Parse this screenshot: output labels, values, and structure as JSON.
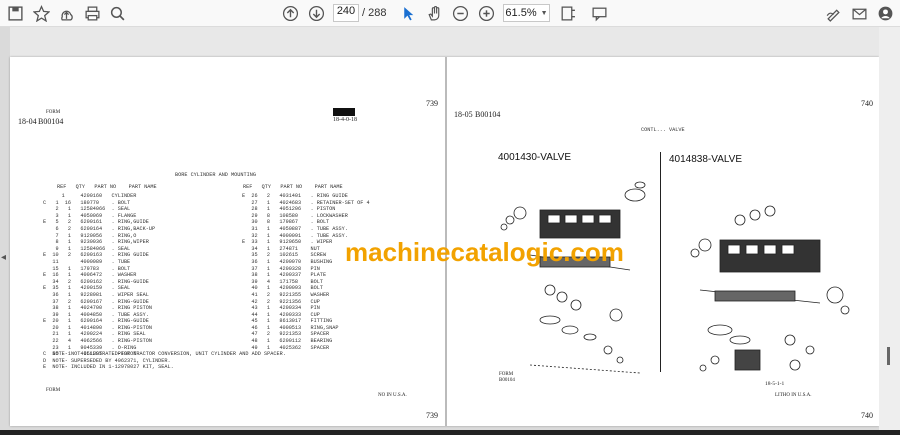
{
  "toolbar": {
    "page_current": "240",
    "page_total": "/ 288",
    "zoom": "61.5%",
    "icons": [
      "save-icon",
      "bookmark-star-icon",
      "upload-icon",
      "print-icon",
      "search-icon",
      "page-up-icon",
      "page-down-icon",
      "select-cursor-icon",
      "hand-icon",
      "zoom-out-icon",
      "zoom-in-icon",
      "fit-page-icon",
      "comment-icon",
      "sign-icon",
      "email-icon",
      "account-icon"
    ]
  },
  "left_page": {
    "page_number_top": "739",
    "page_number_bottom": "739",
    "section": "18-04",
    "form_code": "B00104",
    "form_label": "FORM",
    "stamp": "18-4-0-18",
    "table_title": "BORE CYLINDER AND MOUNTING",
    "col_headers": "REF   QTY   PART NO    PART NAME",
    "col_headers_right": "REF   QTY   PART NO    PART NAME",
    "rows_left": [
      "      1     4200160   CYLINDER",
      "C   1  16   180770    . BOLT",
      "    2   1   12584066  . SEAL",
      "    3   1   4050069   . FLANGE",
      "E   5   2   6200161   . RING,GUIDE",
      "    6   2   6200164   . RING,BACK-UP",
      "    7   1   9120056   . RING,O",
      "    8   1   9230036   . RING,WIPER",
      "    9   1   12584066  . SEAL",
      "E  10   2   6200163   . RING GUIDE",
      "   11       4000089   . TUBE",
      "   15   1   179783    . BOLT",
      "E  16   1   4006472   . WASHER",
      "   34   2   6200162   . RING-GUIDE",
      "E  35   1   4200159   . SEAL",
      "   36   1   9228981   . WIPER SEAL",
      "   37   2   6200167   . RING-GUIDE",
      "   38   1   4024700   . RING PISTON",
      "   39   1   4004850   . TUBE ASSY.",
      "E  20   1   6200164   . RING-GUIDE",
      "   20   1   4014890   . RING-PISTON",
      "   21   1   4200224   . RING SEAL",
      "   22   4   4062566   . RING-PISTON",
      "   23   1   9045339   . O-RING",
      "   25   1   4051205   . PISTON"
    ],
    "rows_right": [
      "E  26   2   4031401   . RING GUIDE",
      "   27   1   4024683   . RETAINER-SET OF 4",
      "   28   1   4051206   . PISTON",
      "   29   8   108580    . LOCKWASHER",
      "   30   8   179867    . BOLT",
      "   31   1   4050887   . TUBE ASSY.",
      "   32   1   4000091   . TUBE ASSY.",
      "E  33   1   9120650   . WIPER",
      "   34   1   274871    NUT",
      "   35   2   102615    SCREW",
      "   36   1   4200070   BUSHING",
      "   37   1   4200328   PIN",
      "   38   1   4200337   PLATE",
      "   39   4   171758    BOLT",
      "   40   1   4200093   BOLT",
      "   41   2   9221355   WASHER",
      "   42   2   9221356   CUP",
      "   43   1   4200334   PIN",
      "   44   1   4200333   CUP",
      "   45   1   8613017   FITTING",
      "   46   1   4000513   RING,SNAP",
      "   47   2   9221353   SPACER",
      "   48   1   6200112   BEARING",
      "   49   1   4025362   SPACER"
    ],
    "notes": [
      "C  NOTE- NOT ILLUSTRATED-FOR TRACTOR CONVERSION, UNIT CYLINDER AND ADD SPACER.",
      "D  NOTE- SUPERSEDED BY 4062371, CYLINDER.",
      "E  NOTE- INCLUDED IN 1-12978027 KIT, SEAL."
    ],
    "footer_form": "FORM",
    "footer_usa": "NO IN U.S.A."
  },
  "right_page": {
    "page_number_top": "740",
    "page_number_bottom": "740",
    "section": "18-05",
    "form_code": "B00104",
    "header_text": "CONTL... VALVE",
    "valve_left": "4001430-VALVE",
    "valve_right": "4014838-VALVE",
    "footer_form": "FORM",
    "footer_form_code": "B00104",
    "footer_code": "18-5-1-1",
    "footer_litho": "LITHO IN U.S.A."
  },
  "watermark": "machinecatalogic.com",
  "colors": {
    "watermark": "#f2a200",
    "toolbar_bg": "#f9f9f9",
    "viewer_bg": "#dadada"
  }
}
